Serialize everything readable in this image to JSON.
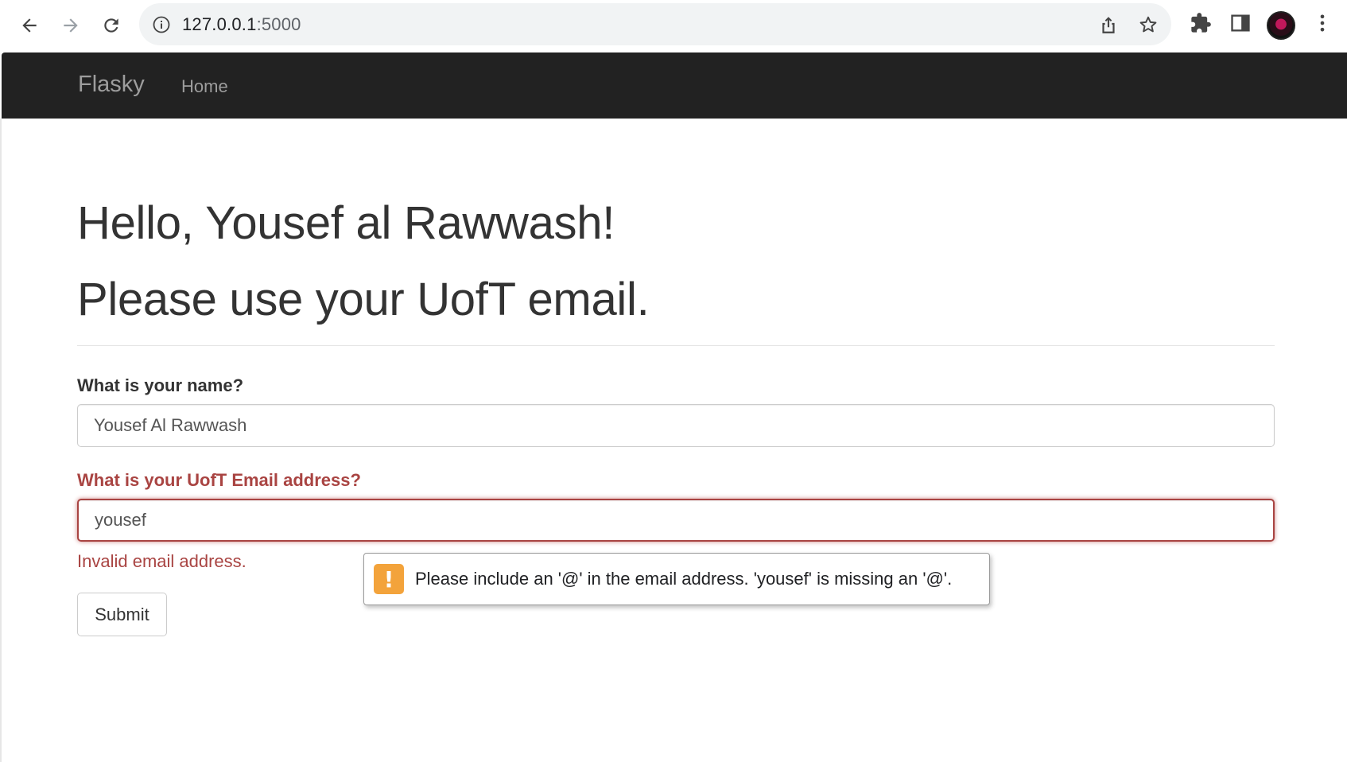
{
  "browser": {
    "url_host": "127.0.0.1",
    "url_port": ":5000"
  },
  "navbar": {
    "brand": "Flasky",
    "links": [
      "Home"
    ]
  },
  "page": {
    "greeting": "Hello, Yousef al Rawwash!",
    "notice": "Please use your UofT email."
  },
  "form": {
    "name_label": "What is your name?",
    "name_value": "Yousef Al Rawwash",
    "email_label": "What is your UofT Email address?",
    "email_value": "yousef",
    "email_error": "Invalid email address.",
    "submit_label": "Submit"
  },
  "validation_bubble": {
    "message": "Please include an '@' in the email address. 'yousef' is missing an '@'."
  },
  "colors": {
    "navbar_bg": "#222222",
    "error_red": "#a94442",
    "warning_orange": "#f3a33b"
  }
}
